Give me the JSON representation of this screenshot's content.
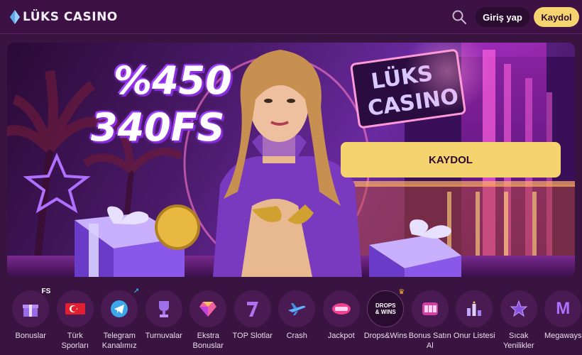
{
  "header": {
    "logo_text": "LÜKS CASINO",
    "login_label": "Giriş yap",
    "register_label": "Kaydol"
  },
  "banner": {
    "promo_line_1": "%450",
    "promo_line_2": "340FS",
    "cta_label": "KAYDOL",
    "sign_text_1": "LÜKS",
    "sign_text_2": "CASINO"
  },
  "categories": [
    {
      "label": "Bonuslar",
      "icon": "gift-icon",
      "badge": "FS"
    },
    {
      "label": "Türk Sporları",
      "icon": "turkey-flag-icon"
    },
    {
      "label": "Telegram Kanalımız",
      "icon": "telegram-icon"
    },
    {
      "label": "Turnuvalar",
      "icon": "trophy-icon"
    },
    {
      "label": "Ekstra Bonuslar",
      "icon": "diamond-icon"
    },
    {
      "label": "TOP Slotlar",
      "icon": "slot-seven-icon"
    },
    {
      "label": "Crash",
      "icon": "airplane-icon"
    },
    {
      "label": "Jackpot",
      "icon": "jackpot-icon"
    },
    {
      "label": "Drops&Wins",
      "icon": "drops-wins-icon",
      "icon_text": "DROPS & WINS"
    },
    {
      "label": "Bonus Satın Al",
      "icon": "slot-machine-icon"
    },
    {
      "label": "Onur Listesi",
      "icon": "leaderboard-icon"
    },
    {
      "label": "Sıcak Yenilikler",
      "icon": "star-icon"
    },
    {
      "label": "Megaways",
      "icon": "megaways-icon",
      "icon_text": "M"
    }
  ],
  "colors": {
    "background": "#3a1440",
    "accent_yellow": "#f5d36e",
    "header_bg": "#3e1145"
  }
}
